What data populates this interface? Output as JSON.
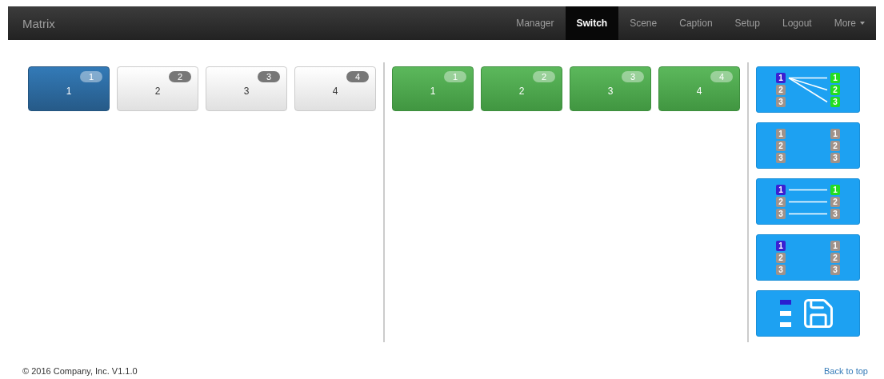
{
  "navbar": {
    "brand": "Matrix",
    "items": [
      {
        "label": "Manager",
        "selected": false
      },
      {
        "label": "Switch",
        "selected": true
      },
      {
        "label": "Scene",
        "selected": false
      },
      {
        "label": "Caption",
        "selected": false
      },
      {
        "label": "Setup",
        "selected": false
      },
      {
        "label": "Logout",
        "selected": false
      },
      {
        "label": "More",
        "selected": false,
        "dropdown": true
      }
    ]
  },
  "inputs": [
    {
      "label": "1",
      "badge": "1",
      "selected": true
    },
    {
      "label": "2",
      "badge": "2",
      "selected": false
    },
    {
      "label": "3",
      "badge": "3",
      "selected": false
    },
    {
      "label": "4",
      "badge": "4",
      "selected": false
    }
  ],
  "outputs": [
    {
      "label": "1",
      "badge": "1"
    },
    {
      "label": "2",
      "badge": "2"
    },
    {
      "label": "3",
      "badge": "3"
    },
    {
      "label": "4",
      "badge": "4"
    }
  ],
  "modes": [
    {
      "kind": "fan",
      "left": [
        {
          "label": "1",
          "active": true
        },
        {
          "label": "2",
          "active": false
        },
        {
          "label": "3",
          "active": false
        }
      ],
      "right": [
        {
          "label": "1",
          "active": true
        },
        {
          "label": "2",
          "active": true
        },
        {
          "label": "3",
          "active": true
        }
      ]
    },
    {
      "kind": "plain",
      "left": [
        {
          "label": "1",
          "active": false
        },
        {
          "label": "2",
          "active": false
        },
        {
          "label": "3",
          "active": false
        }
      ],
      "right": [
        {
          "label": "1",
          "active": false
        },
        {
          "label": "2",
          "active": false
        },
        {
          "label": "3",
          "active": false
        }
      ]
    },
    {
      "kind": "parallel",
      "left": [
        {
          "label": "1",
          "active": true
        },
        {
          "label": "2",
          "active": false
        },
        {
          "label": "3",
          "active": false
        }
      ],
      "right": [
        {
          "label": "1",
          "active": true
        },
        {
          "label": "2",
          "active": false
        },
        {
          "label": "3",
          "active": false
        }
      ]
    },
    {
      "kind": "plain",
      "left": [
        {
          "label": "1",
          "active": true
        },
        {
          "label": "2",
          "active": false
        },
        {
          "label": "3",
          "active": false
        }
      ],
      "right": [
        {
          "label": "1",
          "active": false
        },
        {
          "label": "2",
          "active": false
        },
        {
          "label": "3",
          "active": false
        }
      ]
    },
    {
      "kind": "save",
      "bars": [
        {
          "active": true
        },
        {
          "active": false
        },
        {
          "active": false
        }
      ]
    }
  ],
  "footer": {
    "copyright": "© 2016 Company, Inc. V1.1.0",
    "link": "Back to top"
  }
}
